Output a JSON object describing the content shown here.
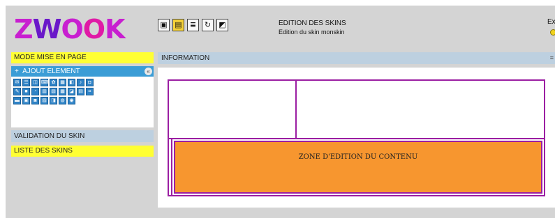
{
  "logo": {
    "text": "ZWOOK",
    "letters": [
      "Z",
      "W",
      "O",
      "O",
      "K"
    ],
    "colors": [
      "#c81fd0",
      "#6a18c9",
      "#c81fd0",
      "#e01aa6",
      "#c81fd0"
    ]
  },
  "toolbar": {
    "buttons": [
      {
        "name": "layout-icon",
        "glyph": "▣",
        "active": false
      },
      {
        "name": "page-icon",
        "glyph": "▤",
        "active": true
      },
      {
        "name": "text-icon",
        "glyph": "≣",
        "active": false
      },
      {
        "name": "refresh-icon",
        "glyph": "↻",
        "active": false
      },
      {
        "name": "image-icon",
        "glyph": "◩",
        "active": false
      }
    ]
  },
  "heading": {
    "title": "EDITION DES SKINS",
    "subtitle": "Edition du skin monskin"
  },
  "exit": {
    "label": "Exi"
  },
  "sidebar": {
    "mode_label": "MODE MISE EN PAGE",
    "add_element_label": "AJOUT ELEMENT",
    "add_element_icon": "+",
    "collapse_icon": "«",
    "validation_label": "VALIDATION DU SKIN",
    "skins_list_label": "LISTE DES SKINS",
    "element_icons": [
      [
        "✉",
        "☰",
        "◫",
        "⌨",
        "✿",
        "▦",
        "◧",
        "♪",
        "◘"
      ],
      [
        "✎",
        "■",
        "◔",
        "▥",
        "▧",
        "▩",
        "◪",
        "▤",
        "⌗"
      ],
      [
        "▬",
        "▣",
        "◙",
        "▨",
        "◨",
        "◍",
        "◉"
      ]
    ]
  },
  "main": {
    "info_label": "INFORMATION",
    "info_toggle": "≡",
    "content_zone_label": "ZONE D'EDITION DU CONTENU"
  }
}
